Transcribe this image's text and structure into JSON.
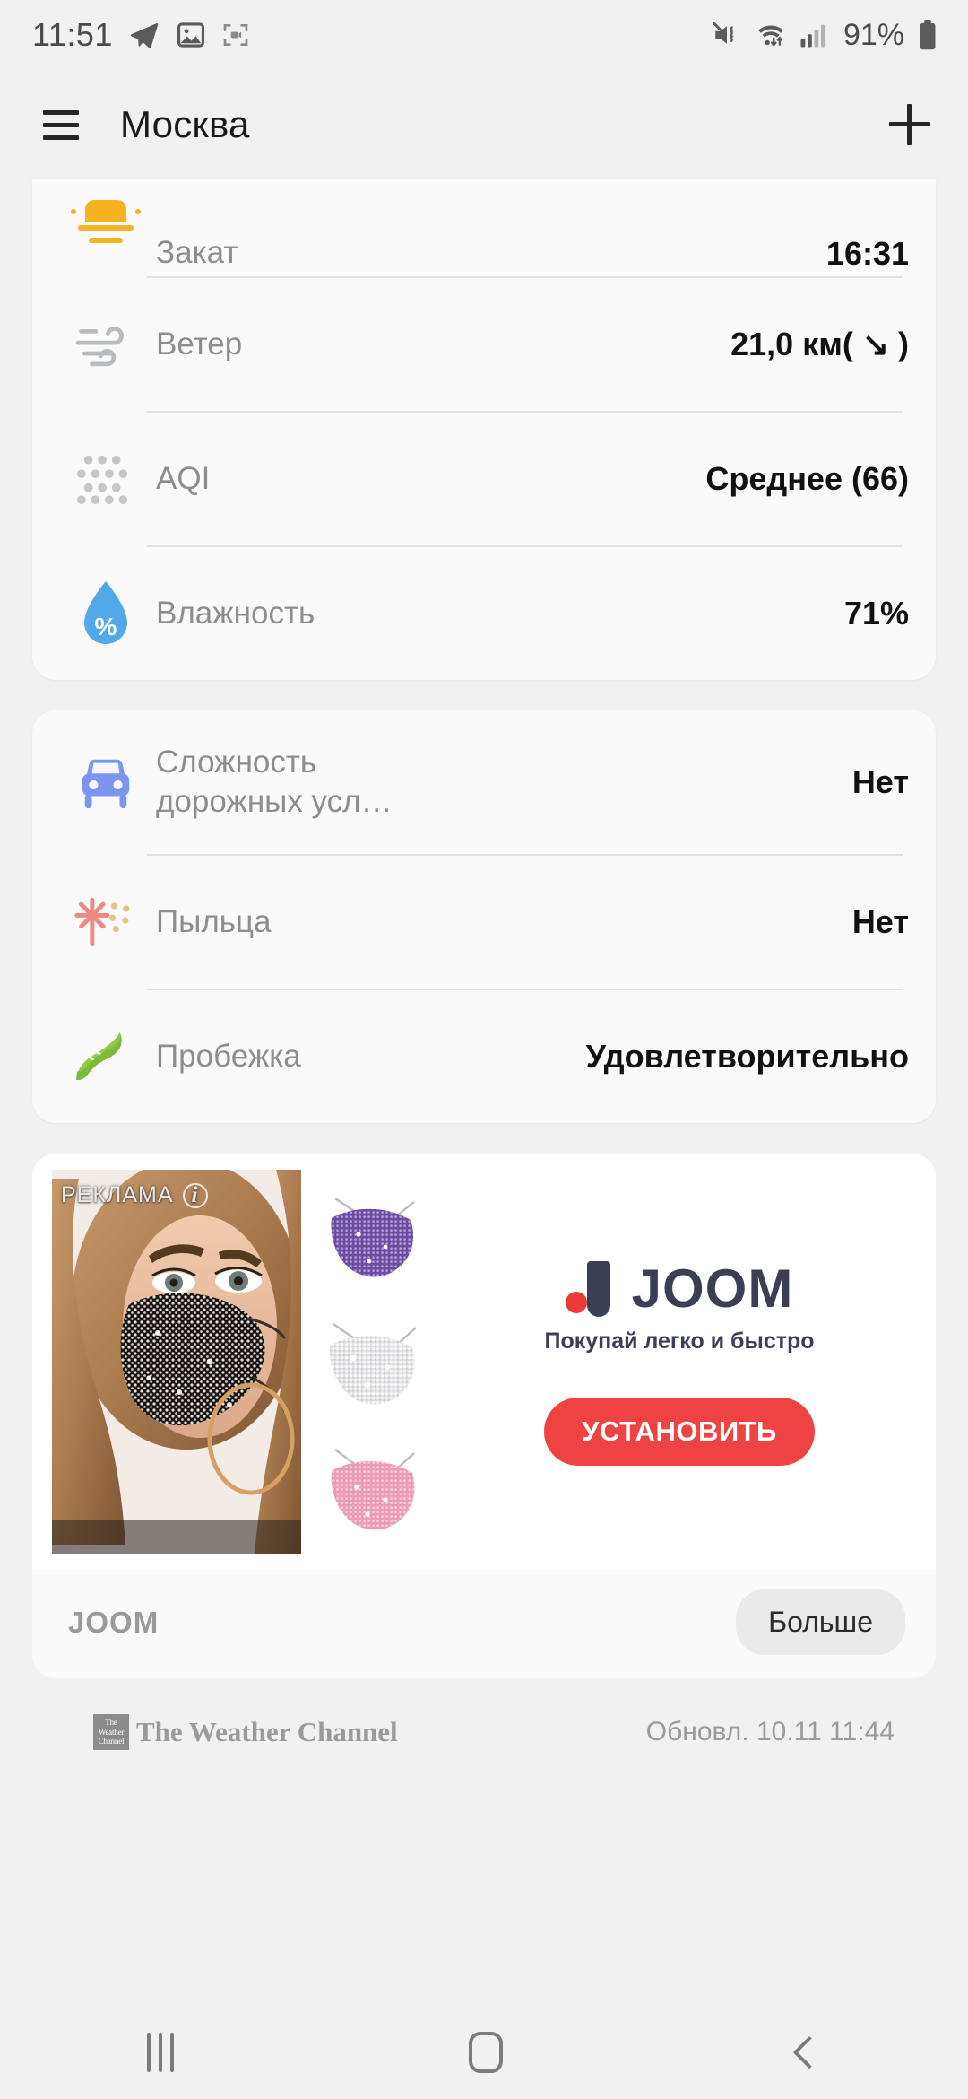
{
  "status_bar": {
    "time": "11:51",
    "battery_percent": "91%",
    "icons": [
      "telegram-icon",
      "gallery-icon",
      "screen-recorder-icon",
      "mute-vibrate-icon",
      "wifi-icon",
      "signal-icon",
      "battery-icon"
    ]
  },
  "app_bar": {
    "title": "Москва",
    "menu_icon": "hamburger-icon",
    "add_icon": "plus-icon"
  },
  "details_card": {
    "rows": [
      {
        "icon": "sunset-icon",
        "label": "Закат",
        "value": "16:31"
      },
      {
        "icon": "wind-icon",
        "label": "Ветер",
        "value": "21,0 км( ↘ )"
      },
      {
        "icon": "aqi-icon",
        "label": "AQI",
        "value": "Среднее (66)"
      },
      {
        "icon": "humidity-icon",
        "label": "Влажность",
        "value": "71%"
      }
    ]
  },
  "lifestyle_card": {
    "rows": [
      {
        "icon": "car-icon",
        "label": "Сложность\nдорожных усл…",
        "value": "Нет"
      },
      {
        "icon": "pollen-icon",
        "label": "Пыльца",
        "value": "Нет"
      },
      {
        "icon": "running-icon",
        "label": "Пробежка",
        "value": "Удовлетворительно"
      }
    ]
  },
  "ad": {
    "badge": "РЕКЛАМА",
    "info_icon": "info-icon",
    "brand": "JOOM",
    "tagline": "Покупай легко и быстро",
    "install_label": "УСТАНОВИТЬ",
    "footer_name": "JOOM",
    "more_label": "Больше",
    "accent_color": "#ef4242",
    "logo_color": "#3b3f54",
    "thumbnails": [
      "purple-mask-thumb",
      "white-mask-thumb",
      "pink-mask-thumb"
    ]
  },
  "attribution": {
    "provider": "The Weather Channel",
    "logo_line1": "The",
    "logo_line2": "Weather",
    "logo_line3": "Channel",
    "updated": "Обновл. 10.11 11:44"
  },
  "nav_bar": {
    "recents": "recents-icon",
    "home": "home-icon",
    "back": "back-icon"
  }
}
